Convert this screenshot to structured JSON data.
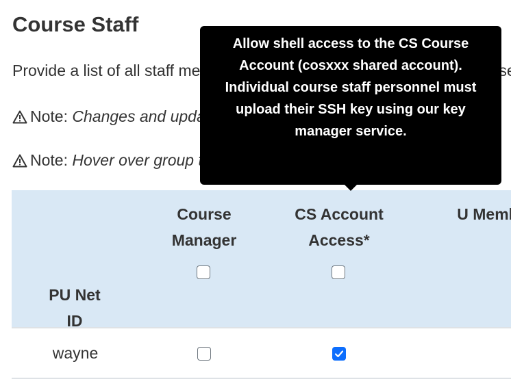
{
  "page": {
    "title": "Course Staff",
    "intro": "Provide a list of all staff members who will be associated with the course, ir",
    "notes": [
      {
        "label": "Note:",
        "text": "Changes and updates to staff list will be reflected ."
      },
      {
        "label": "Note:",
        "text": "Hover over group titles for more info."
      }
    ]
  },
  "tooltip": {
    "text": "Allow shell access to the CS Course Account (cosxxx shared account). Individual course staff personnel must upload their SSH key using our key manager service."
  },
  "table": {
    "headers": {
      "netid": "PU Net ID",
      "course_manager": "Course Manager",
      "cs_account": "CS Account Access*",
      "unix_member": "U Memb"
    },
    "header_checkboxes": {
      "course_manager": false,
      "cs_account": false
    },
    "rows": [
      {
        "netid": "wayne",
        "course_manager": false,
        "cs_account": true
      }
    ]
  },
  "colors": {
    "header_bg": "#d9e8f5",
    "checkbox_checked": "#0d6efd",
    "tooltip_bg": "#000000"
  },
  "icons": {
    "note": "warning-triangle-icon"
  }
}
